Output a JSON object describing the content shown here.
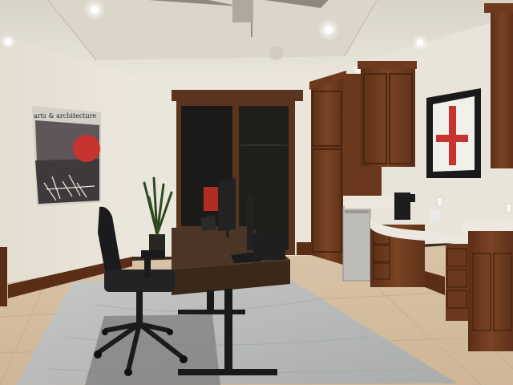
{
  "scene": {
    "description_text": "",
    "poster_text": "arts & architecture",
    "watermark_text": ""
  },
  "colors": {
    "wall": "#e7e2d7",
    "ceiling": "#ece7dd",
    "floor_tile": "#d9c3a6",
    "cabinet_wood": "#6b3a1e",
    "baseboard": "#5a2e16",
    "countertop": "#ece8df",
    "rug": "#b7b9b8",
    "desk_top": "#4a3526",
    "chair": "#1b1b1d",
    "door_frame": "#5b3420",
    "art_red": "#c7342f"
  }
}
